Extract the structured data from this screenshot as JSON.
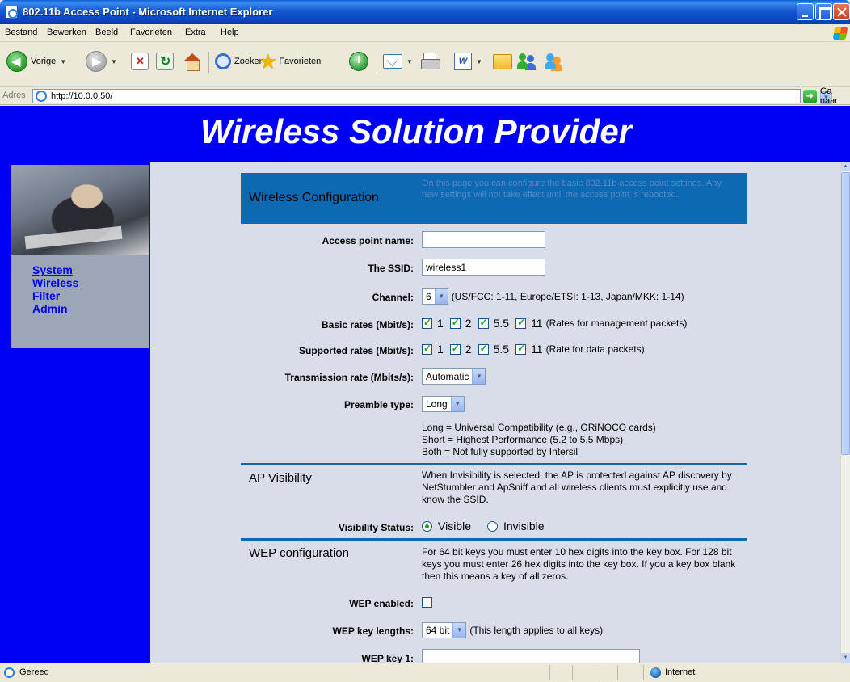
{
  "window": {
    "title": "802.11b Access Point - Microsoft Internet Explorer"
  },
  "menu": {
    "items": [
      "Bestand",
      "Bewerken",
      "Beeld",
      "Favorieten",
      "Extra",
      "Help"
    ]
  },
  "toolbar": {
    "back_label": "Vorige",
    "search_label": "Zoeken",
    "favorites_label": "Favorieten"
  },
  "address": {
    "label": "Adres",
    "url": "http://10.0.0.50/",
    "go_label": "Ga naar"
  },
  "page": {
    "banner": "Wireless Solution Provider",
    "nav": [
      "System",
      "Wireless",
      "Filter",
      "Admin"
    ],
    "header": {
      "title": "Wireless Configuration",
      "description": "On this page you can configure the basic 802.11b access point settings. Any new settings will not take effect until the access point is rebooted."
    },
    "fields": {
      "ap_name": {
        "label": "Access point name:",
        "value": ""
      },
      "ssid": {
        "label": "The SSID:",
        "value": "wireless1"
      },
      "channel": {
        "label": "Channel:",
        "value": "6",
        "note": "(US/FCC: 1-11, Europe/ETSI: 1-13, Japan/MKK: 1-14)"
      },
      "basic_rates": {
        "label": "Basic rates (Mbit/s):",
        "rates": [
          "1",
          "2",
          "5.5",
          "11"
        ],
        "checked": [
          true,
          true,
          true,
          true
        ],
        "note": "(Rates for management packets)"
      },
      "supported_rates": {
        "label": "Supported rates (Mbit/s):",
        "rates": [
          "1",
          "2",
          "5.5",
          "11"
        ],
        "checked": [
          true,
          true,
          true,
          true
        ],
        "note": "(Rate for data packets)"
      },
      "tx_rate": {
        "label": "Transmission rate (Mbits/s):",
        "value": "Automatic"
      },
      "preamble": {
        "label": "Preamble type:",
        "value": "Long"
      },
      "preamble_help": [
        "Long = Universal Compatibility (e.g., ORiNOCO cards)",
        "Short = Highest Performance (5.2 to 5.5 Mbps)",
        "Both = Not fully supported by Intersil"
      ]
    },
    "ap_visibility": {
      "title": "AP Visibility",
      "description": "When Invisibility is selected, the AP is protected against AP discovery by NetStumbler and ApSniff and all wireless clients must explicitly use and know the SSID.",
      "status_label": "Visibility Status:",
      "options": [
        "Visible",
        "Invisible"
      ],
      "selected": "Visible"
    },
    "wep": {
      "title": "WEP configuration",
      "description": "For 64 bit keys you must enter 10 hex digits into the key box. For 128 bit keys you must enter 26 hex digits into the key box. If you a key box blank then this means a key of all zeros.",
      "enabled_label": "WEP enabled:",
      "enabled": false,
      "key_lengths_label": "WEP key lengths:",
      "key_length": "64 bit",
      "key_length_note": "(This length applies to all keys)",
      "key1_label": "WEP key 1:",
      "key1_value": ""
    }
  },
  "status": {
    "text": "Gereed",
    "zone": "Internet"
  },
  "colors": {
    "banner_blue": "#0000F5",
    "header_blue": "#0C69B2",
    "content_bg": "#D9DDE9",
    "nav_panel": "#9DA6B9"
  }
}
